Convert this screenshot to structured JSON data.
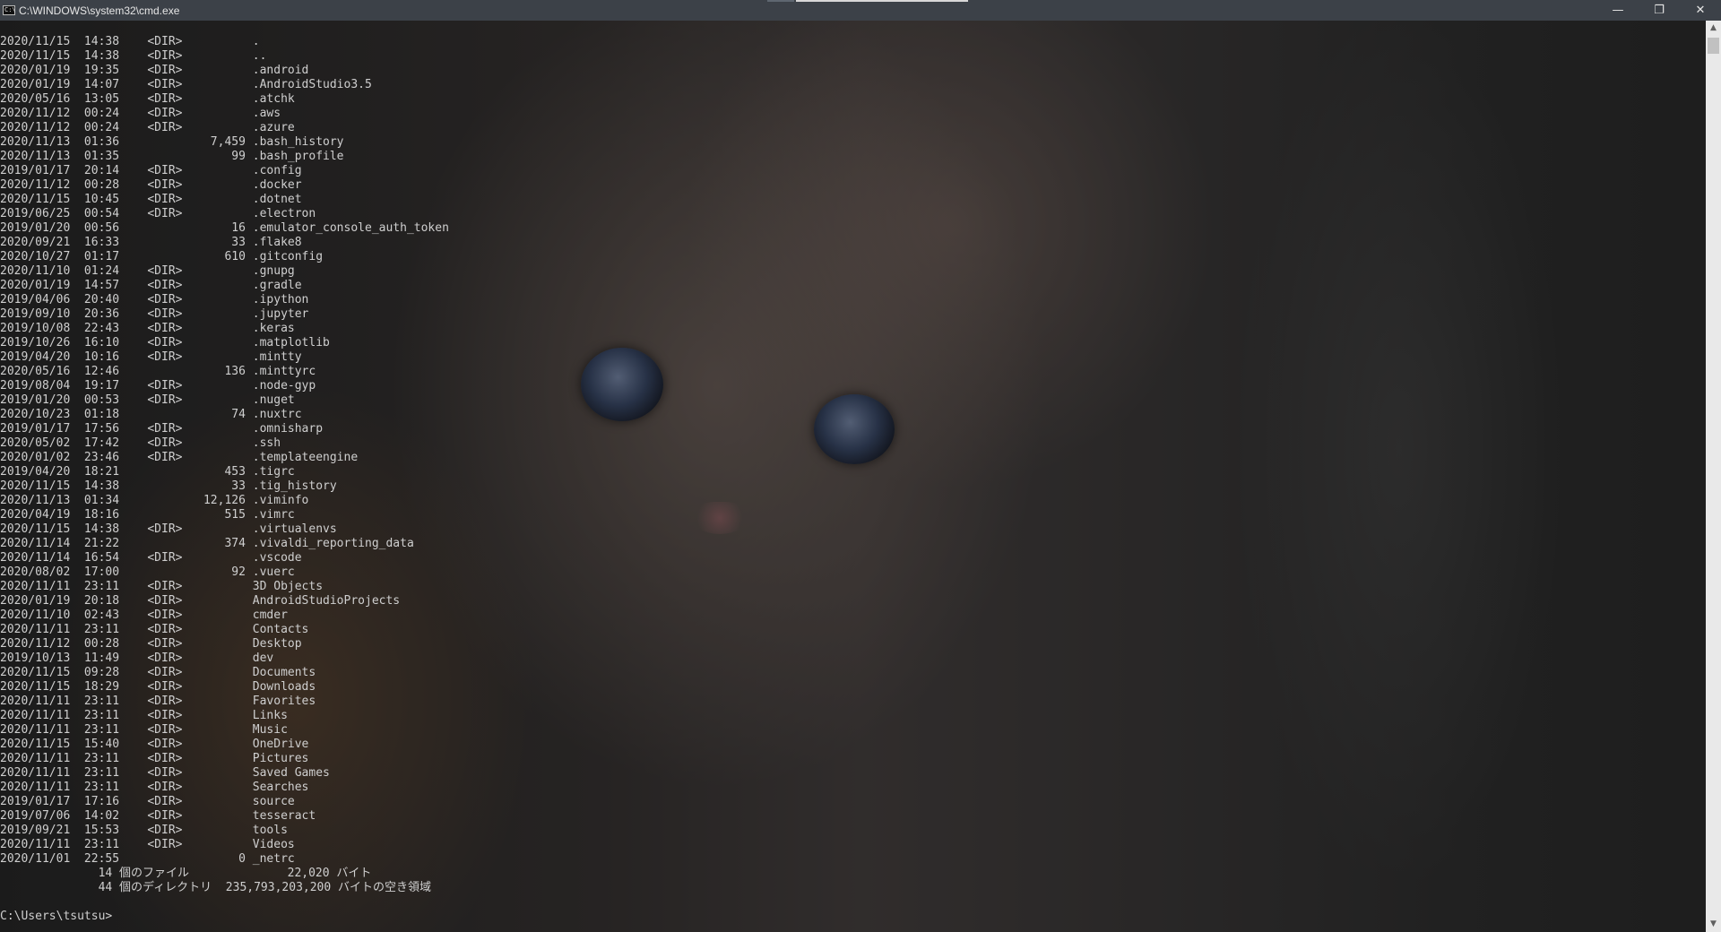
{
  "window": {
    "title": "C:\\WINDOWS\\system32\\cmd.exe",
    "icon_name": "console-icon",
    "controls": {
      "minimize": "—",
      "restore": "❐",
      "close": "✕"
    }
  },
  "console": {
    "entries": [
      "2020/11/15  14:38    <DIR>          .",
      "2020/11/15  14:38    <DIR>          ..",
      "2020/01/19  19:35    <DIR>          .android",
      "2020/01/19  14:07    <DIR>          .AndroidStudio3.5",
      "2020/05/16  13:05    <DIR>          .atchk",
      "2020/11/12  00:24    <DIR>          .aws",
      "2020/11/12  00:24    <DIR>          .azure",
      "2020/11/13  01:36             7,459 .bash_history",
      "2020/11/13  01:35                99 .bash_profile",
      "2019/01/17  20:14    <DIR>          .config",
      "2020/11/12  00:28    <DIR>          .docker",
      "2020/11/15  10:45    <DIR>          .dotnet",
      "2019/06/25  00:54    <DIR>          .electron",
      "2019/01/20  00:56                16 .emulator_console_auth_token",
      "2020/09/21  16:33                33 .flake8",
      "2020/10/27  01:17               610 .gitconfig",
      "2020/11/10  01:24    <DIR>          .gnupg",
      "2020/01/19  14:57    <DIR>          .gradle",
      "2019/04/06  20:40    <DIR>          .ipython",
      "2019/09/10  20:36    <DIR>          .jupyter",
      "2019/10/08  22:43    <DIR>          .keras",
      "2019/10/26  16:10    <DIR>          .matplotlib",
      "2019/04/20  10:16    <DIR>          .mintty",
      "2020/05/16  12:46               136 .minttyrc",
      "2019/08/04  19:17    <DIR>          .node-gyp",
      "2019/01/20  00:53    <DIR>          .nuget",
      "2020/10/23  01:18                74 .nuxtrc",
      "2019/01/17  17:56    <DIR>          .omnisharp",
      "2020/05/02  17:42    <DIR>          .ssh",
      "2020/01/02  23:46    <DIR>          .templateengine",
      "2019/04/20  18:21               453 .tigrc",
      "2020/11/15  14:38                33 .tig_history",
      "2020/11/13  01:34            12,126 .viminfo",
      "2020/04/19  18:16               515 .vimrc",
      "2020/11/15  14:38    <DIR>          .virtualenvs",
      "2020/11/14  21:22               374 .vivaldi_reporting_data",
      "2020/11/14  16:54    <DIR>          .vscode",
      "2020/08/02  17:00                92 .vuerc",
      "2020/11/11  23:11    <DIR>          3D Objects",
      "2020/01/19  20:18    <DIR>          AndroidStudioProjects",
      "2020/11/10  02:43    <DIR>          cmder",
      "2020/11/11  23:11    <DIR>          Contacts",
      "2020/11/12  00:28    <DIR>          Desktop",
      "2019/10/13  11:49    <DIR>          dev",
      "2020/11/15  09:28    <DIR>          Documents",
      "2020/11/15  18:29    <DIR>          Downloads",
      "2020/11/11  23:11    <DIR>          Favorites",
      "2020/11/11  23:11    <DIR>          Links",
      "2020/11/11  23:11    <DIR>          Music",
      "2020/11/15  15:40    <DIR>          OneDrive",
      "2020/11/11  23:11    <DIR>          Pictures",
      "2020/11/11  23:11    <DIR>          Saved Games",
      "2020/11/11  23:11    <DIR>          Searches",
      "2019/01/17  17:16    <DIR>          source",
      "2019/07/06  14:02    <DIR>          tesseract",
      "2019/09/21  15:53    <DIR>          tools",
      "2020/11/11  23:11    <DIR>          Videos",
      "2020/11/01  22:55                 0 _netrc"
    ],
    "summary_files": "              14 個のファイル              22,020 バイト",
    "summary_dirs": "              44 個のディレクトリ  235,793,203,200 バイトの空き領域",
    "blank": "",
    "prompt": "C:\\Users\\tsutsu>"
  },
  "scrollbar": {
    "up_arrow": "▲",
    "down_arrow": "▼"
  }
}
